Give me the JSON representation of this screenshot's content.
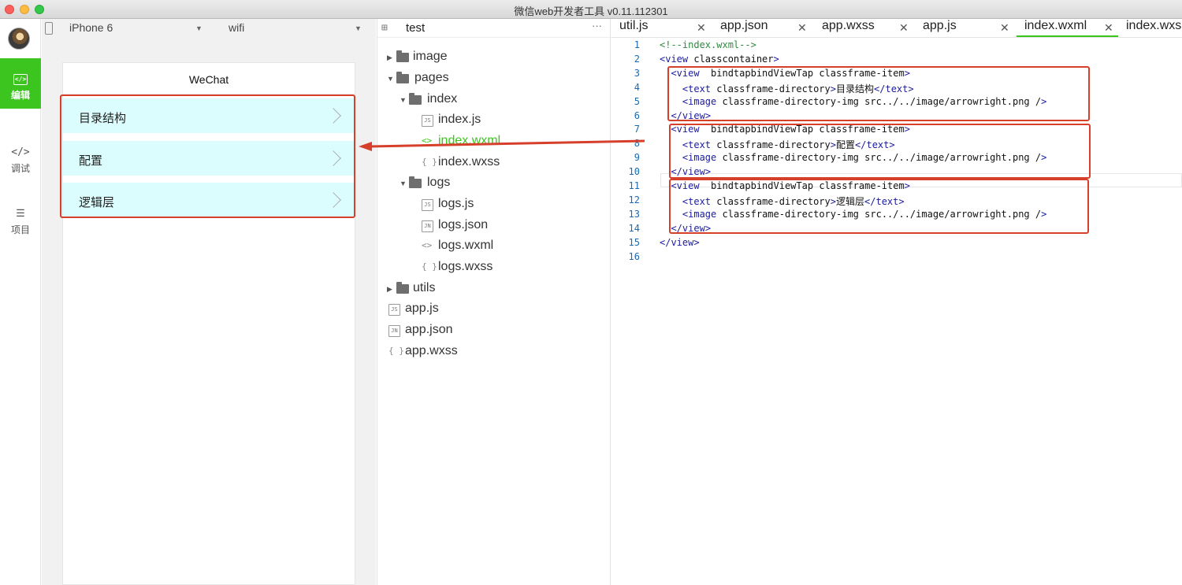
{
  "window": {
    "title": "微信web开发者工具 v0.11.112301"
  },
  "sidebar": {
    "items": [
      {
        "label": "编辑",
        "icon": "code-edit-icon"
      },
      {
        "label": "调试",
        "icon": "code-brackets-icon"
      },
      {
        "label": "项目",
        "icon": "menu-lines-icon"
      }
    ]
  },
  "simulator": {
    "device": "iPhone 6",
    "network": "wifi",
    "nav_title": "WeChat",
    "items": [
      "目录结构",
      "配置",
      "逻辑层"
    ]
  },
  "filetree": {
    "project": "test",
    "nodes": [
      {
        "name": "image",
        "type": "folder",
        "open": false
      },
      {
        "name": "pages",
        "type": "folder",
        "open": true
      },
      {
        "name": "index",
        "type": "folder",
        "open": true
      },
      {
        "name": "index.js",
        "type": "js"
      },
      {
        "name": "index.wxml",
        "type": "wxml"
      },
      {
        "name": "index.wxss",
        "type": "wxss"
      },
      {
        "name": "logs",
        "type": "folder",
        "open": true
      },
      {
        "name": "logs.js",
        "type": "js"
      },
      {
        "name": "logs.json",
        "type": "json"
      },
      {
        "name": "logs.wxml",
        "type": "wxml"
      },
      {
        "name": "logs.wxss",
        "type": "wxss"
      },
      {
        "name": "utils",
        "type": "folder",
        "open": false
      },
      {
        "name": "app.js",
        "type": "js"
      },
      {
        "name": "app.json",
        "type": "json"
      },
      {
        "name": "app.wxss",
        "type": "wxss"
      }
    ]
  },
  "editor": {
    "tabs": [
      "util.js",
      "app.json",
      "app.wxss",
      "app.js",
      "index.wxml",
      "index.wxs"
    ],
    "active_tab": "index.wxml",
    "line_numbers": [
      "1",
      "2",
      "3",
      "4",
      "5",
      "6",
      "7",
      "8",
      "9",
      "10",
      "11",
      "12",
      "13",
      "14",
      "15",
      "16"
    ],
    "code": [
      "<!--index.wxml-->",
      "<view class=\"container\">",
      "  <view  bindtap=\"bindViewTap\" class=\"frame-item\">",
      "    <text class=\"frame-directory\">目录结构</text>",
      "    <image class=\"frame-directory-img\" src=\"../../image/arrowright.png\" />",
      "  </view>",
      "  <view  bindtap=\"bindViewTap\" class=\"frame-item\">",
      "    <text class=\"frame-directory\">配置</text>",
      "    <image class=\"frame-directory-img\" src=\"../../image/arrowright.png\" />",
      "  </view>",
      "  <view  bindtap=\"bindViewTap\" class=\"frame-item\">",
      "    <text class=\"frame-directory\">逻辑层</text>",
      "    <image class=\"frame-directory-img\" src=\"../../image/arrowright.png\" />",
      "  </view>",
      "</view>",
      ""
    ]
  },
  "colors": {
    "accent": "#3cc51f",
    "annotation": "#d6402b",
    "item_bg": "#dcfdfe"
  }
}
